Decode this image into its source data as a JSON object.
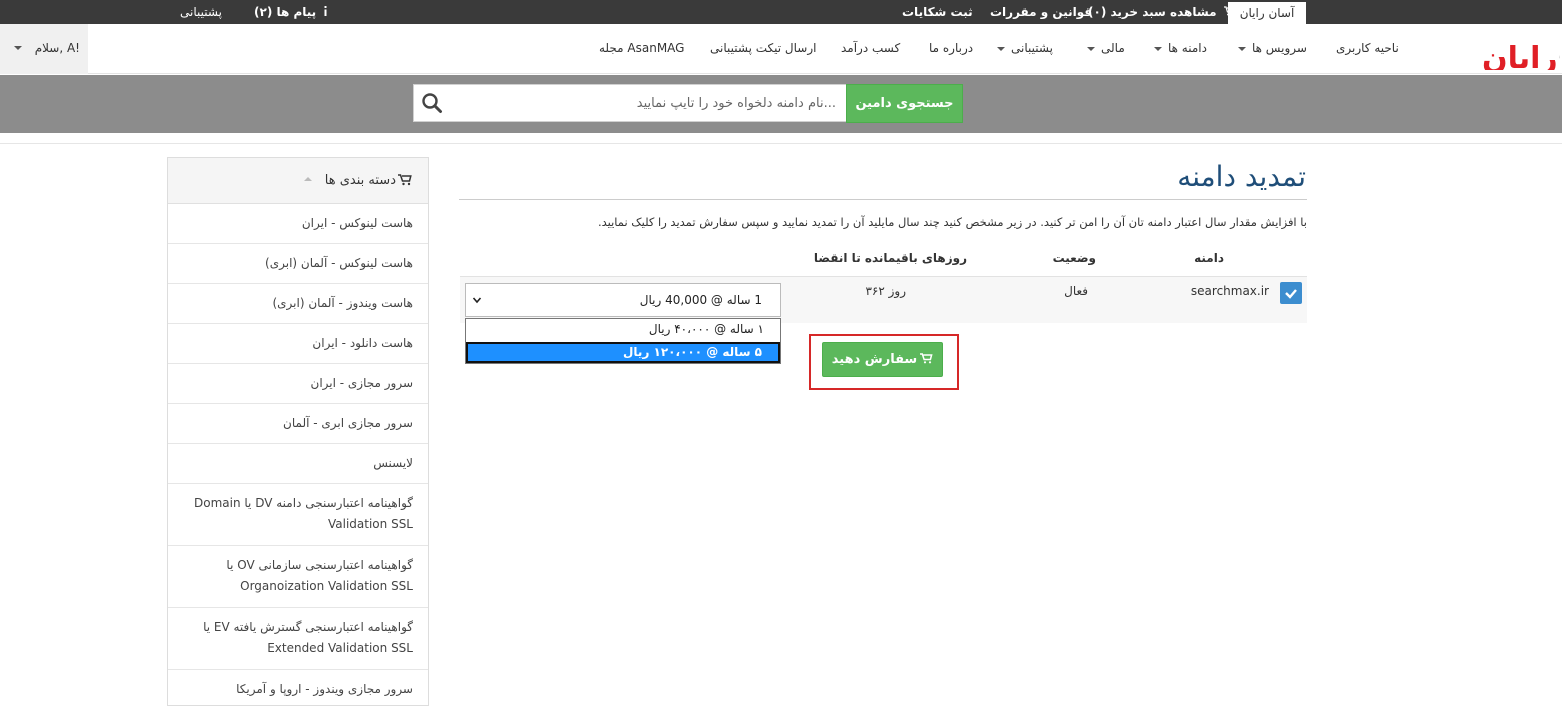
{
  "topbar": {
    "brand_tab": "آسان رایان",
    "cart_link": "مشاهده سبد خرید (۰)",
    "rules_link": "قوانین و مقررات",
    "complaints_link": "ثبت شکایات",
    "messages_link": "پیام ها (۲)",
    "support_link": "پشتیبانی"
  },
  "navbar": {
    "items": [
      {
        "label": "ناحیه کاربری",
        "dropdown": false
      },
      {
        "label": "سرویس ها",
        "dropdown": true
      },
      {
        "label": "دامنه ها",
        "dropdown": true
      },
      {
        "label": "مالی",
        "dropdown": true
      },
      {
        "label": "پشتیبانی",
        "dropdown": true
      },
      {
        "label": "درباره ما",
        "dropdown": false
      },
      {
        "label": "کسب درآمد",
        "dropdown": false
      },
      {
        "label": "ارسال تیکت پشتیبانی",
        "dropdown": false
      },
      {
        "label": "مجله AsanMAG",
        "dropdown": false
      }
    ],
    "user_greeting": "سلام, A!"
  },
  "search": {
    "placeholder": "...نام دامنه دلخواه خود را تایپ نمایید",
    "button_label": "جستجوی دامین"
  },
  "sidebar": {
    "title": "دسته بندی ها",
    "items": [
      "هاست لینوکس - ایران",
      "هاست لینوکس - آلمان (ابری)",
      "هاست ویندوز - آلمان (ابری)",
      "هاست دانلود - ایران",
      "سرور مجازی - ایران",
      "سرور مجازی ابری - آلمان",
      "لایسنس",
      "گواهینامه اعتبارسنجی دامنه DV یا Domain Validation SSL",
      "گواهینامه اعتبارسنجی سازمانی OV یا Organoization Validation SSL",
      "گواهینامه اعتبارسنجی گسترش یافته EV یا Extended Validation SSL",
      "سرور مجازی ویندوز - اروپا و آمریکا"
    ]
  },
  "main": {
    "title": "تمدید دامنه",
    "description": "با افزایش مقدار سال اعتبار دامنه تان آن را امن تر کنید. در زیر مشخص کنید چند سال مایلید آن را تمدید نمایید و سپس سفارش تمدید را کلیک نمایید.",
    "table": {
      "headers": {
        "domain": "دامنه",
        "status": "وضعیت",
        "days_left": "روزهای باقیمانده تا انقضا"
      },
      "row": {
        "checked": true,
        "domain": "searchmax.ir",
        "status": "فعال",
        "days_left": "۳۶۲ روز",
        "selected_period": "1 ساله @ 40,000 ریال",
        "options": [
          "۱ ساله @ ۴۰،۰۰۰ ریال",
          "۵ ساله @ ۱۲۰،۰۰۰ ریال"
        ],
        "highlighted_option": 1
      }
    },
    "order_button": "سفارش دهید"
  },
  "colors": {
    "green": "#5cb85c",
    "title_blue": "#1f4e79",
    "checkbox_blue": "#3c8dcf",
    "highlight_blue": "#1e90ff",
    "frame_red": "#d62828",
    "logo_red": "#e01f26"
  },
  "icons": {
    "cart": "cart-icon",
    "search": "search-icon",
    "check": "check-icon",
    "chevron": "chevron-down-icon",
    "info": "info-icon"
  }
}
